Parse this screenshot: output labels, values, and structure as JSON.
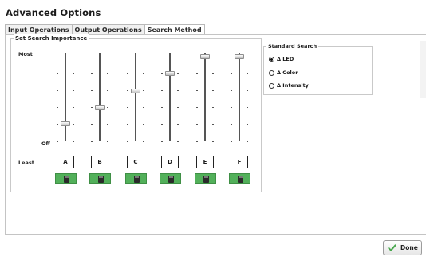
{
  "window": {
    "title": "Advanced Options"
  },
  "tabs": [
    {
      "label": "Input Operations",
      "active": false
    },
    {
      "label": "Output Operations",
      "active": false
    },
    {
      "label": "Search Method",
      "active": true
    }
  ],
  "importance": {
    "title": "Set Search Importance",
    "label_most": "Most",
    "label_off": "Off",
    "label_least": "Least",
    "sliders": [
      {
        "letter": "A",
        "level": 0.21
      },
      {
        "letter": "B",
        "level": 0.4
      },
      {
        "letter": "C",
        "level": 0.59
      },
      {
        "letter": "D",
        "level": 0.8
      },
      {
        "letter": "E",
        "level": 1.0
      },
      {
        "letter": "F",
        "level": 1.0
      }
    ],
    "swatch_color": "#52b05a"
  },
  "standard_search": {
    "title": "Standard Search",
    "options": [
      {
        "label": "Δ LED",
        "selected": true
      },
      {
        "label": "Δ Color",
        "selected": false
      },
      {
        "label": "Δ Intensity",
        "selected": false
      }
    ]
  },
  "footer": {
    "done_label": "Done",
    "done_icon": "check-icon"
  }
}
